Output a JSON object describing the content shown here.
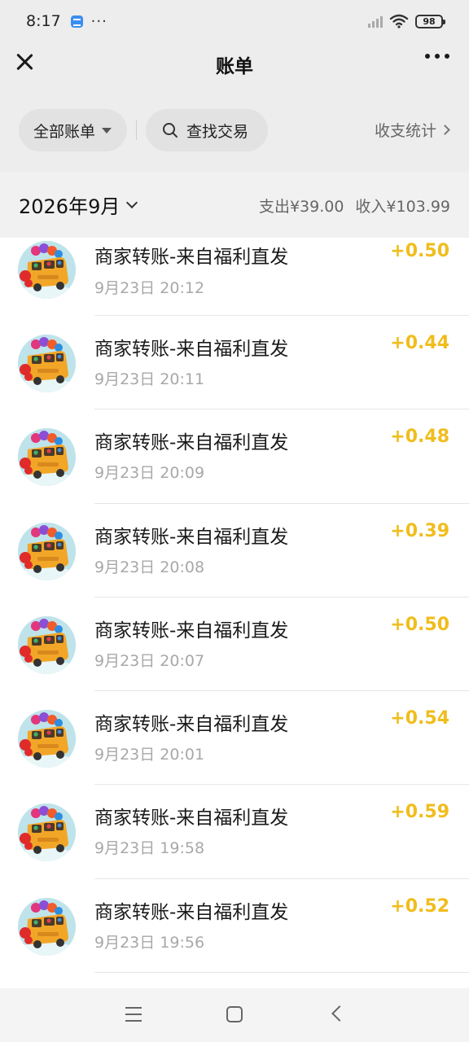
{
  "status_bar": {
    "time": "8:17",
    "battery": "98"
  },
  "header": {
    "title": "账单"
  },
  "filters": {
    "all_bills": "全部账单",
    "search": "查找交易",
    "stats": "收支统计"
  },
  "summary": {
    "month": "2026年9月",
    "expense": "支出¥39.00",
    "income": "收入¥103.99"
  },
  "transactions": [
    {
      "title": "商家转账-来自福利直发",
      "time": "9月23日 20:12",
      "amount": "+0.50"
    },
    {
      "title": "商家转账-来自福利直发",
      "time": "9月23日 20:11",
      "amount": "+0.44"
    },
    {
      "title": "商家转账-来自福利直发",
      "time": "9月23日 20:09",
      "amount": "+0.48"
    },
    {
      "title": "商家转账-来自福利直发",
      "time": "9月23日 20:08",
      "amount": "+0.39"
    },
    {
      "title": "商家转账-来自福利直发",
      "time": "9月23日 20:07",
      "amount": "+0.50"
    },
    {
      "title": "商家转账-来自福利直发",
      "time": "9月23日 20:01",
      "amount": "+0.54"
    },
    {
      "title": "商家转账-来自福利直发",
      "time": "9月23日 19:58",
      "amount": "+0.59"
    },
    {
      "title": "商家转账-来自福利直发",
      "time": "9月23日 19:56",
      "amount": "+0.52"
    }
  ],
  "icons": {
    "close": "close-icon",
    "more": "more-icon",
    "search": "search-icon",
    "avatar": "bus-toy-avatar"
  },
  "colors": {
    "amount": "#f0bd1c",
    "page_bg": "#ededed",
    "list_bg": "#ffffff"
  }
}
